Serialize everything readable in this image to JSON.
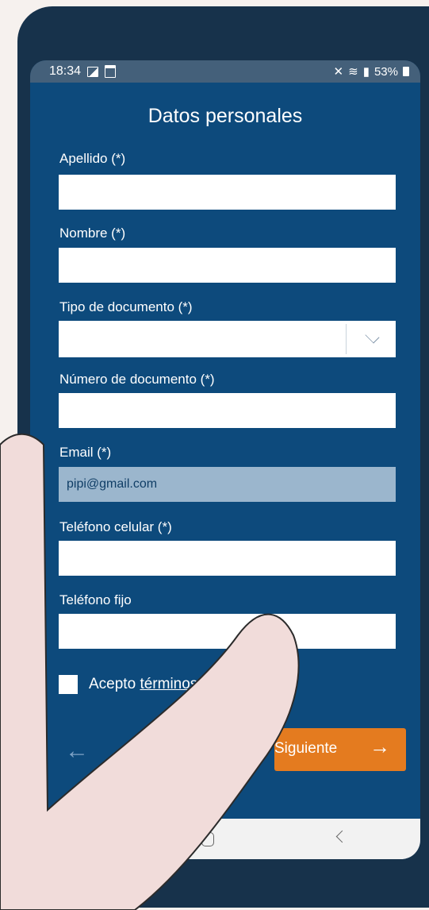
{
  "status": {
    "time": "18:34",
    "battery": "53%"
  },
  "form": {
    "title": "Datos personales",
    "fields": [
      {
        "label": "Apellido (*)",
        "value": ""
      },
      {
        "label": "Nombre (*)",
        "value": ""
      },
      {
        "label": "Tipo de documento (*)",
        "value": ""
      },
      {
        "label": "Número de documento (*)",
        "value": ""
      },
      {
        "label": "Email (*)",
        "value": "pipi@gmail.com"
      },
      {
        "label": "Teléfono celular (*)",
        "value": ""
      },
      {
        "label": "Teléfono fijo",
        "value": ""
      }
    ],
    "terms_prefix": "Acepto ",
    "terms_link": "términos y condiciones",
    "back_arrow": "←",
    "next_label": "Siguiente",
    "next_arrow": "→"
  },
  "colors": {
    "screen_bg": "#0d4a7c",
    "accent": "#e47b1f",
    "phone_body": "#17324b"
  }
}
